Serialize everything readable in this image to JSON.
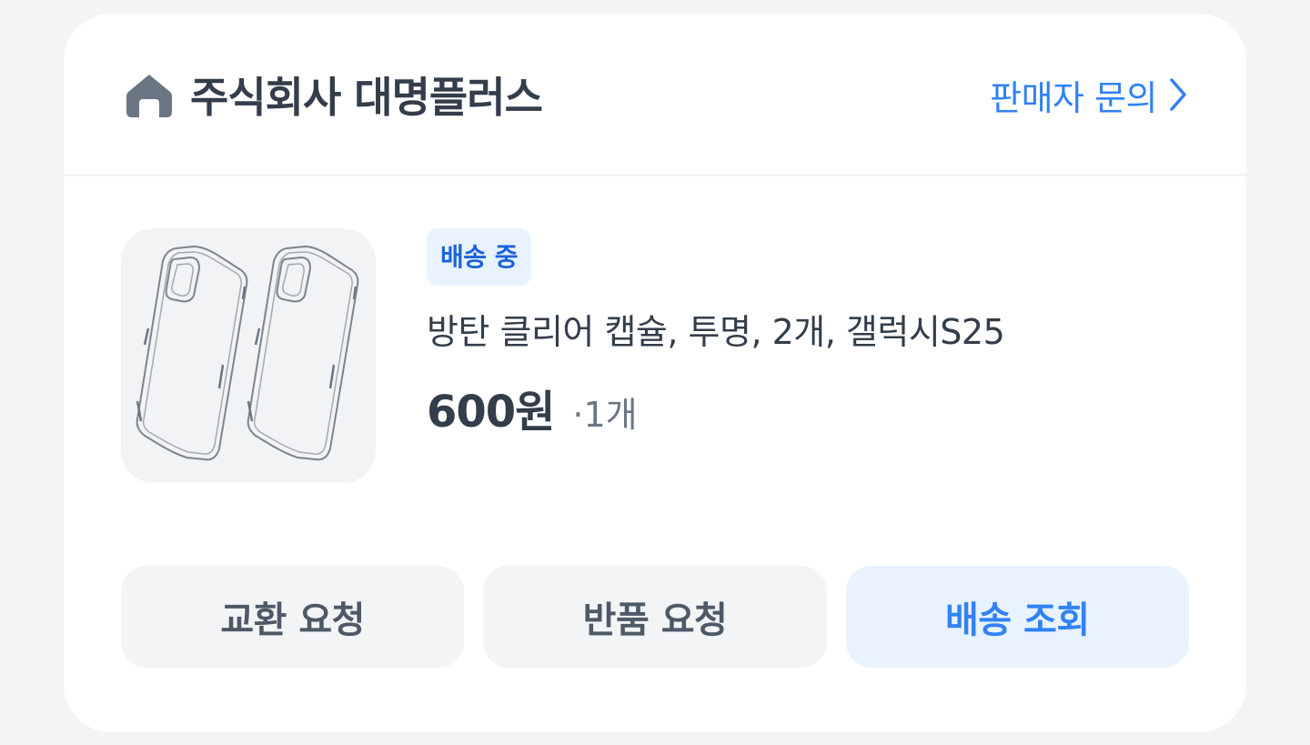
{
  "seller": {
    "icon": "home-icon",
    "name": "주식회사 대명플러스",
    "inquiry_label": "판매자 문의",
    "inquiry_icon": "chevron-right-icon"
  },
  "order_item": {
    "status": "배송 중",
    "product_name": "방탄 클리어 캡슐, 투명, 2개, 갤럭시S25",
    "price": "600원",
    "quantity": "·1개",
    "thumbnail": "clear-phone-case-image"
  },
  "actions": [
    {
      "label": "교환 요청"
    },
    {
      "label": "반품 요청"
    },
    {
      "label": "배송 조회"
    }
  ],
  "colors": {
    "background": "#f2f4f6",
    "card": "#ffffff",
    "accent": "#3182f6",
    "badge_bg": "#e8f3ff",
    "badge_text": "#1b64da",
    "text_primary": "#333d4b",
    "text_secondary": "#6b7684"
  }
}
